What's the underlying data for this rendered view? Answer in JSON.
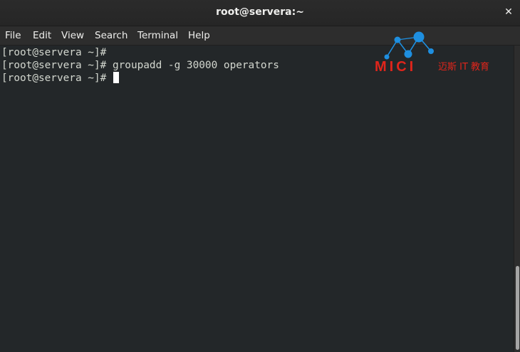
{
  "window": {
    "title": "root@servera:~",
    "close_label": "✕"
  },
  "menu": [
    "File",
    "Edit",
    "View",
    "Search",
    "Terminal",
    "Help"
  ],
  "terminal": {
    "lines": [
      "[root@servera ~]#",
      "[root@servera ~]# groupadd -g 30000 operators",
      "[root@servera ~]# "
    ]
  },
  "watermark": {
    "brand": "MICI",
    "subtitle": "迈斯 IT 教育",
    "color": "#e0251b",
    "accent": "#1e8fe0"
  },
  "icons": {
    "close": "close-icon"
  }
}
